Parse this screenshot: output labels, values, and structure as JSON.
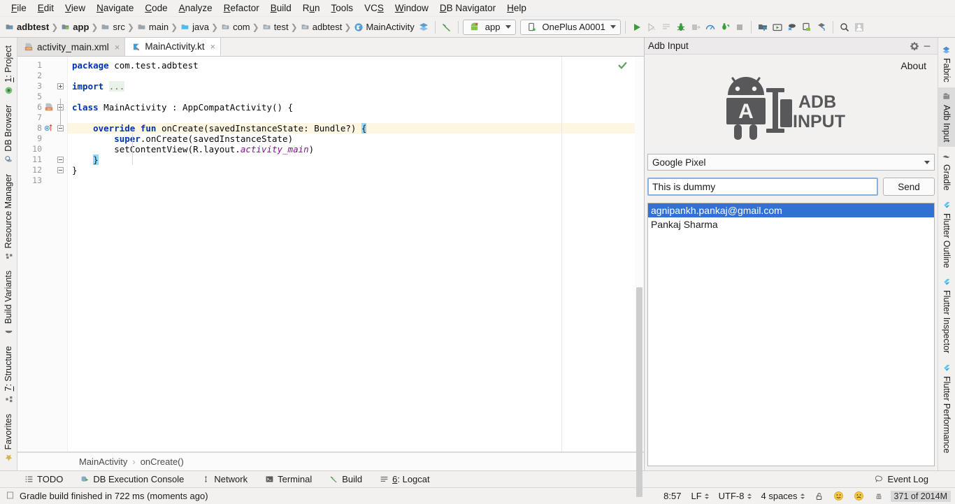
{
  "menu": {
    "items": [
      {
        "label": "File",
        "mnemonic": "F"
      },
      {
        "label": "Edit",
        "mnemonic": "E"
      },
      {
        "label": "View",
        "mnemonic": "V"
      },
      {
        "label": "Navigate",
        "mnemonic": "N"
      },
      {
        "label": "Code",
        "mnemonic": "C"
      },
      {
        "label": "Analyze",
        "mnemonic": "A"
      },
      {
        "label": "Refactor",
        "mnemonic": "R"
      },
      {
        "label": "Build",
        "mnemonic": "B"
      },
      {
        "label": "Run",
        "mnemonic": "u"
      },
      {
        "label": "Tools",
        "mnemonic": "T"
      },
      {
        "label": "VCS",
        "mnemonic": "S"
      },
      {
        "label": "Window",
        "mnemonic": "W"
      },
      {
        "label": "DB Navigator",
        "mnemonic": "D"
      },
      {
        "label": "Help",
        "mnemonic": "H"
      }
    ]
  },
  "toolbar": {
    "breadcrumbs": [
      {
        "label": "adbtest",
        "icon": "module-icon",
        "bold": true
      },
      {
        "label": "app",
        "icon": "app-module-icon",
        "bold": true
      },
      {
        "label": "src",
        "icon": "folder-icon",
        "bold": false
      },
      {
        "label": "main",
        "icon": "folder-icon",
        "bold": false
      },
      {
        "label": "java",
        "icon": "source-folder-icon",
        "bold": false
      },
      {
        "label": "com",
        "icon": "package-icon",
        "bold": false
      },
      {
        "label": "test",
        "icon": "package-icon",
        "bold": false
      },
      {
        "label": "adbtest",
        "icon": "package-icon",
        "bold": false
      },
      {
        "label": "MainActivity",
        "icon": "kotlin-class-icon",
        "bold": false
      }
    ],
    "layers_icon": "layers-icon",
    "build_icon": "hammer-icon",
    "run_config": {
      "label": "app",
      "icon": "android-app-icon"
    },
    "device": {
      "label": "OnePlus A0001",
      "icon": "device-icon"
    },
    "actions": [
      {
        "name": "run-button",
        "icon": "play-icon",
        "enabled": true
      },
      {
        "name": "debug-button",
        "icon": "debug-icon",
        "enabled": false
      },
      {
        "name": "run-with-coverage-button",
        "icon": "coverage-icon",
        "enabled": false
      },
      {
        "name": "attach-debugger-button",
        "icon": "bug-icon",
        "enabled": true
      },
      {
        "name": "attach-process-button",
        "icon": "attach-icon",
        "enabled": false
      },
      {
        "name": "profiler-button",
        "icon": "profiler-icon",
        "enabled": true
      },
      {
        "name": "apply-changes-button",
        "icon": "apply-changes-icon",
        "enabled": true
      },
      {
        "name": "stop-button",
        "icon": "stop-icon",
        "enabled": false
      },
      {
        "name": "sdk-manager-button",
        "icon": "sdk-manager-icon",
        "enabled": true
      },
      {
        "name": "avd-manager-button",
        "icon": "avd-manager-icon",
        "enabled": true
      },
      {
        "name": "sync-gradle-button",
        "icon": "sync-gradle-icon",
        "enabled": true
      },
      {
        "name": "device-file-explorer-button",
        "icon": "device-explorer-icon",
        "enabled": true
      },
      {
        "name": "layout-inspector-button",
        "icon": "layout-inspector-icon",
        "enabled": true
      },
      {
        "name": "search-everywhere-button",
        "icon": "search-icon",
        "enabled": true
      },
      {
        "name": "user-account-button",
        "icon": "avatar-icon",
        "enabled": true
      }
    ]
  },
  "left_strip": {
    "tabs": [
      {
        "label": "1: Project",
        "mnemonic": "1",
        "icon": "project-icon",
        "active": false
      },
      {
        "label": "DB Browser",
        "icon": "db-browser-icon",
        "active": false
      },
      {
        "label": "Resource Manager",
        "icon": "resource-manager-icon",
        "active": false
      },
      {
        "label": "Build Variants",
        "icon": "build-variants-icon",
        "active": false
      },
      {
        "label": "7: Structure",
        "mnemonic": "7",
        "icon": "structure-icon",
        "active": false
      },
      {
        "label": "Favorites",
        "icon": "favorites-icon",
        "active": false
      }
    ]
  },
  "right_strip": {
    "tabs": [
      {
        "label": "Fabric",
        "icon": "fabric-icon",
        "active": false
      },
      {
        "label": "Adb Input",
        "icon": "adb-input-icon",
        "active": true
      },
      {
        "label": "Gradle",
        "icon": "gradle-icon",
        "active": false
      },
      {
        "label": "Flutter Outline",
        "icon": "flutter-icon",
        "active": false
      },
      {
        "label": "Flutter Inspector",
        "icon": "flutter-icon",
        "active": false
      },
      {
        "label": "Flutter Performance",
        "icon": "flutter-icon",
        "active": false
      }
    ]
  },
  "editor": {
    "tabs": [
      {
        "label": "activity_main.xml",
        "icon": "xml-layout-icon",
        "active": false,
        "close": "×"
      },
      {
        "label": "MainActivity.kt",
        "icon": "kotlin-file-icon",
        "active": true,
        "close": "×"
      }
    ],
    "line_numbers": [
      "1",
      "2",
      "3",
      "5",
      "6",
      "7",
      "8",
      "9",
      "10",
      "11",
      "12",
      "13"
    ],
    "code_lines": [
      {
        "n": "1",
        "tokens": [
          {
            "t": "package",
            "c": "kw"
          },
          {
            "t": " com.test.adbtest",
            "c": "plain"
          }
        ]
      },
      {
        "n": "2",
        "tokens": []
      },
      {
        "n": "3",
        "tokens": [
          {
            "t": "import",
            "c": "kw"
          },
          {
            "t": " ",
            "c": "plain"
          },
          {
            "t": "...",
            "c": "fold"
          }
        ]
      },
      {
        "n": "5",
        "tokens": []
      },
      {
        "n": "6",
        "tokens": [
          {
            "t": "class",
            "c": "kw"
          },
          {
            "t": " MainActivity : AppCompatActivity() {",
            "c": "plain"
          }
        ]
      },
      {
        "n": "7",
        "tokens": []
      },
      {
        "n": "8",
        "highlight": true,
        "tokens": [
          {
            "t": "    ",
            "c": "plain"
          },
          {
            "t": "override fun",
            "c": "kw"
          },
          {
            "t": " onCreate(savedInstanceState: Bundle?) ",
            "c": "plain"
          },
          {
            "t": "{",
            "c": "brmatch"
          }
        ]
      },
      {
        "n": "9",
        "tokens": [
          {
            "t": "        ",
            "c": "plain"
          },
          {
            "t": "super",
            "c": "kw"
          },
          {
            "t": ".onCreate(savedInstanceState)",
            "c": "plain"
          }
        ]
      },
      {
        "n": "10",
        "tokens": [
          {
            "t": "        setContentView(R.layout.",
            "c": "plain"
          },
          {
            "t": "activity_main",
            "c": "ital"
          },
          {
            "t": ")",
            "c": "plain"
          }
        ]
      },
      {
        "n": "11",
        "tokens": [
          {
            "t": "    ",
            "c": "plain"
          },
          {
            "t": "}",
            "c": "brmatch"
          }
        ]
      },
      {
        "n": "12",
        "tokens": [
          {
            "t": "}",
            "c": "plain"
          }
        ]
      },
      {
        "n": "13",
        "tokens": []
      }
    ],
    "inspection_status": "no-errors-checkmark",
    "breadcrumb": [
      {
        "label": "MainActivity"
      },
      {
        "label": "onCreate()"
      }
    ],
    "breadcrumb_separator": "›"
  },
  "adb_panel": {
    "title": "Adb Input",
    "settings_icon": "gear-icon",
    "minimize_icon": "minimize-icon",
    "about_label": "About",
    "logo": {
      "text_line1": "ADB",
      "text_line2": "INPUT",
      "badge_letter": "A",
      "icon": "android-robot-icon"
    },
    "device_select": {
      "value": "Google Pixel",
      "icon": "chevron-down-icon"
    },
    "text_input": {
      "value": "This is dummy",
      "placeholder": ""
    },
    "send_button": "Send",
    "list_items": [
      {
        "label": "agnipankh.pankaj@gmail.com",
        "selected": true
      },
      {
        "label": "Pankaj Sharma",
        "selected": false
      }
    ]
  },
  "bottom_bar": {
    "tool_windows": [
      {
        "label": "TODO",
        "icon": "todo-icon"
      },
      {
        "label": "DB Execution Console",
        "icon": "db-console-icon"
      },
      {
        "label": "Network",
        "icon": "network-icon"
      },
      {
        "label": "Terminal",
        "icon": "terminal-icon"
      },
      {
        "label": "Build",
        "icon": "build-hammer-icon"
      },
      {
        "label": "6: Logcat",
        "mnemonic": "6",
        "icon": "logcat-icon"
      }
    ],
    "event_log": {
      "label": "Event Log",
      "icon": "event-log-icon"
    }
  },
  "status_bar": {
    "message": "Gradle build finished in 722 ms (moments ago)",
    "message_icon": "status-doc-icon",
    "caret_position": "8:57",
    "line_separator": "LF",
    "encoding": "UTF-8",
    "indent": "4 spaces",
    "lock_icon": "unlocked-icon",
    "smiley_happy": "🙂",
    "smiley_sad": "🙁",
    "inspector_icon": "inspector-icon",
    "memory": "371 of 2014M"
  },
  "colors": {
    "accent_selection": "#2f72d4",
    "chrome": "#f2f1f0",
    "editor_bg": "#ffffff",
    "highlight_line": "#fdf6e3",
    "keyword": "#0033b3",
    "run_green": "#3a9c3a",
    "logo_gray": "#58585a"
  }
}
